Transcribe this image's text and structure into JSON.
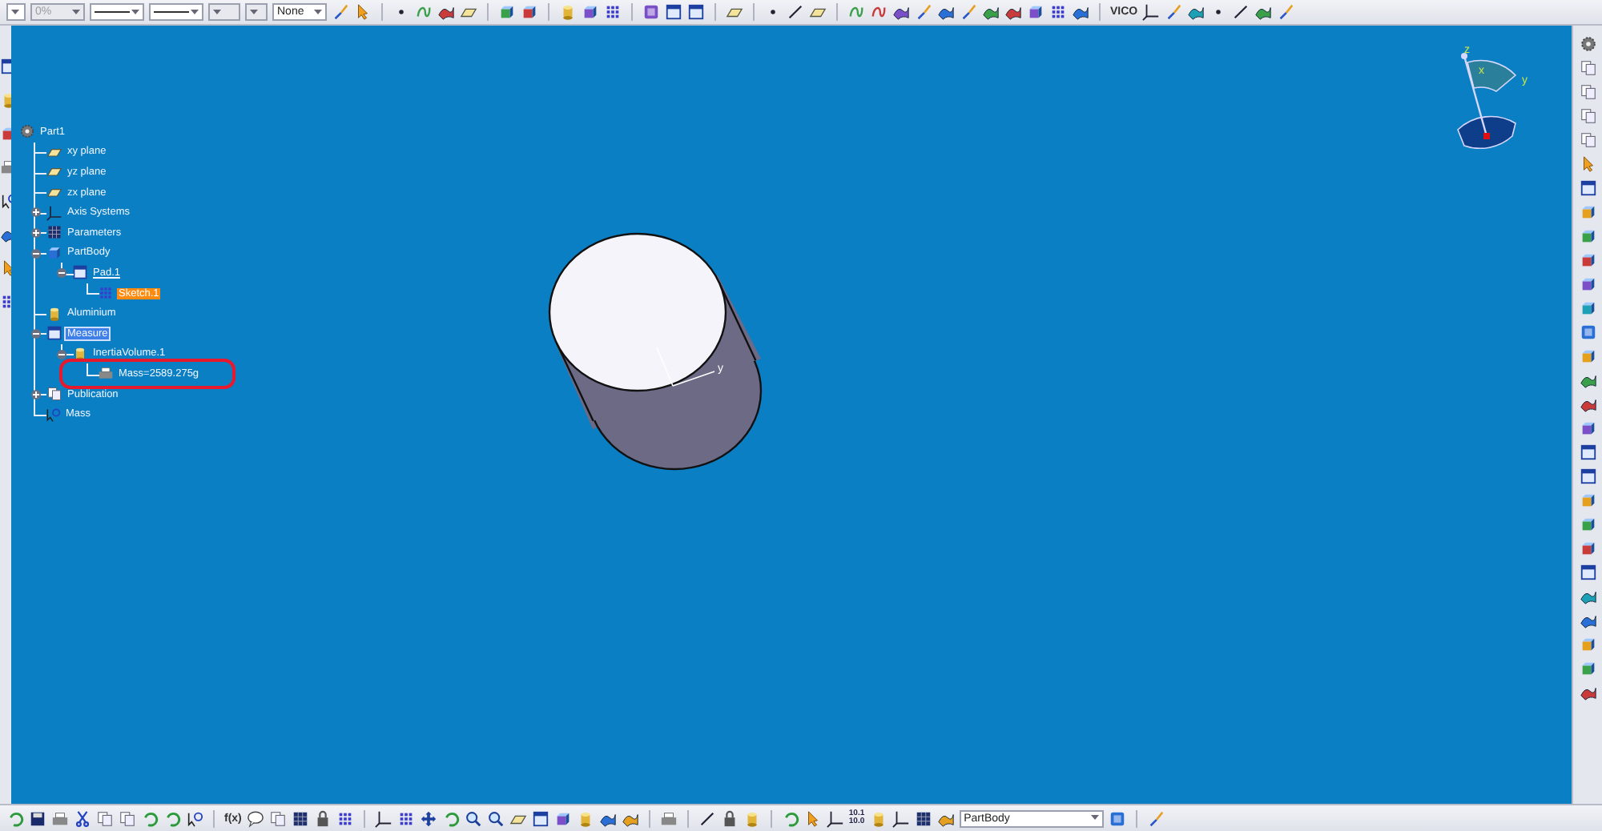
{
  "toolbar_top": {
    "dropdowns": [
      {
        "value": "0%",
        "disabled": true
      },
      {
        "value": "None",
        "disabled": false
      }
    ],
    "label": "VICO"
  },
  "tree": [
    {
      "label": "Part1",
      "kind": "part",
      "selected": false,
      "highlighted": false,
      "underlined": false,
      "children": [
        {
          "label": "xy plane",
          "kind": "plane",
          "selected": false,
          "highlighted": false,
          "underlined": false
        },
        {
          "label": "yz plane",
          "kind": "plane",
          "selected": false,
          "highlighted": false,
          "underlined": false
        },
        {
          "label": "zx plane",
          "kind": "plane",
          "selected": false,
          "highlighted": false,
          "underlined": false
        },
        {
          "label": "Axis Systems",
          "kind": "axis",
          "selected": false,
          "highlighted": false,
          "underlined": false,
          "expanded": false
        },
        {
          "label": "Parameters",
          "kind": "parameters",
          "selected": false,
          "highlighted": false,
          "underlined": false,
          "expanded": false
        },
        {
          "label": "PartBody",
          "kind": "body",
          "selected": false,
          "highlighted": false,
          "underlined": false,
          "expanded": true,
          "children": [
            {
              "label": "Pad.1",
              "kind": "pad",
              "selected": false,
              "highlighted": false,
              "underlined": true,
              "expanded": true,
              "children": [
                {
                  "label": "Sketch.1",
                  "kind": "sketch",
                  "selected": false,
                  "highlighted": true,
                  "underlined": false
                }
              ]
            }
          ]
        },
        {
          "label": "Aluminium",
          "kind": "material",
          "selected": false,
          "highlighted": false,
          "underlined": false
        },
        {
          "label": "Measure",
          "kind": "measure",
          "selected": true,
          "highlighted": false,
          "underlined": false,
          "expanded": true,
          "children": [
            {
              "label": "InertiaVolume.1",
              "kind": "inertia",
              "selected": false,
              "highlighted": false,
              "underlined": false,
              "expanded": true,
              "children": [
                {
                  "label": "Mass=2589.275g",
                  "kind": "mass",
                  "selected": false,
                  "highlighted": false,
                  "underlined": false,
                  "circled": true
                }
              ]
            }
          ]
        },
        {
          "label": "Publication",
          "kind": "publication",
          "selected": false,
          "highlighted": false,
          "underlined": false,
          "expanded": false
        },
        {
          "label": "Mass",
          "kind": "law",
          "selected": false,
          "highlighted": false,
          "underlined": false
        }
      ]
    }
  ],
  "model": {
    "axis_label": "y"
  },
  "compass": {
    "labels": [
      "z",
      "x",
      "y"
    ]
  },
  "toolbar_bottom": {
    "function_label": "f(x)",
    "grid_values": [
      "10.1",
      "10.0"
    ],
    "body_select": "PartBody"
  }
}
